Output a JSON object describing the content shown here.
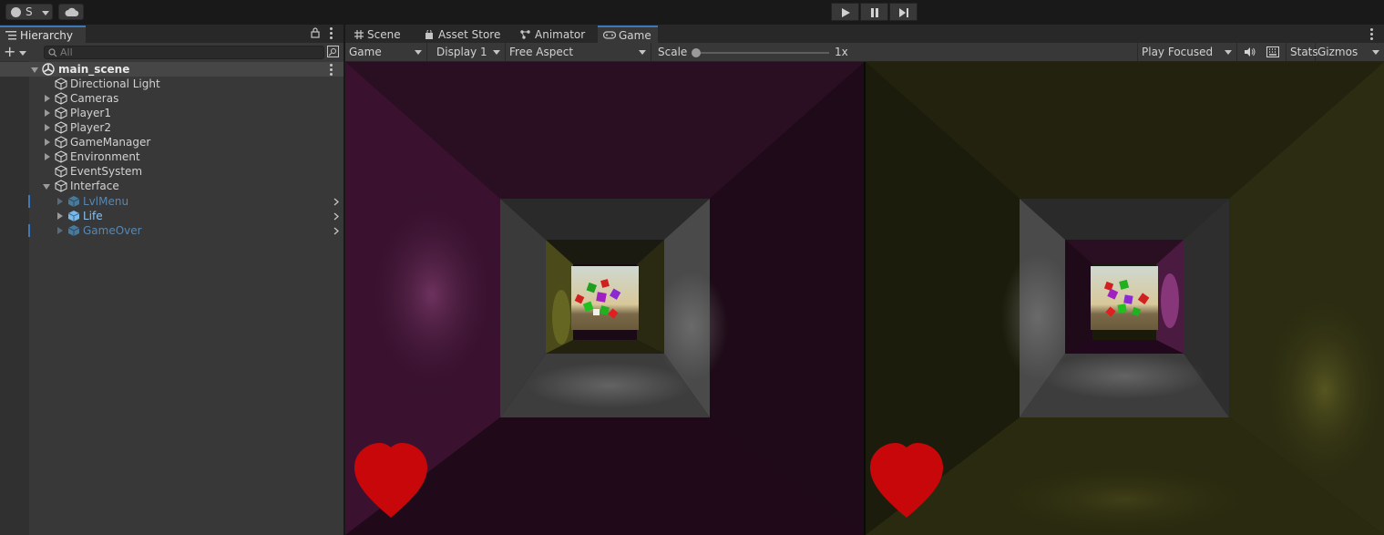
{
  "toolbar": {
    "account_label": "S",
    "play_icon": "play-icon",
    "pause_icon": "pause-icon",
    "step_icon": "step-icon"
  },
  "hierarchy": {
    "tab_label": "Hierarchy",
    "search_placeholder": "All",
    "items": [
      {
        "label": "main_scene",
        "type": "scene",
        "expanded": true
      },
      {
        "label": "Directional Light",
        "type": "object"
      },
      {
        "label": "Cameras",
        "type": "object",
        "has_children": true
      },
      {
        "label": "Player1",
        "type": "object",
        "has_children": true
      },
      {
        "label": "Player2",
        "type": "object",
        "has_children": true
      },
      {
        "label": "GameManager",
        "type": "object",
        "has_children": true
      },
      {
        "label": "Environment",
        "type": "object",
        "has_children": true
      },
      {
        "label": "EventSystem",
        "type": "object"
      },
      {
        "label": "Interface",
        "type": "object",
        "expanded": true
      },
      {
        "label": "LvlMenu",
        "type": "prefab-inactive",
        "has_children": true
      },
      {
        "label": "Life",
        "type": "prefab",
        "has_children": true
      },
      {
        "label": "GameOver",
        "type": "prefab-inactive",
        "has_children": true
      }
    ]
  },
  "tabs": [
    {
      "label": "Scene",
      "icon": "grid-icon"
    },
    {
      "label": "Asset Store",
      "icon": "bag-icon"
    },
    {
      "label": "Animator",
      "icon": "animator-icon"
    },
    {
      "label": "Game",
      "icon": "gamepad-icon",
      "active": true
    }
  ],
  "game_controls": {
    "view_mode": "Game",
    "display": "Display 1",
    "aspect": "Free Aspect",
    "scale_label": "Scale",
    "scale_value": "1x",
    "play_mode": "Play Focused",
    "stats_label": "Stats",
    "gizmos_label": "Gizmos"
  },
  "viewports": [
    {
      "name": "player1-view",
      "tint": "#4a1a3a",
      "accent": "#6a2a5a"
    },
    {
      "name": "player2-view",
      "tint": "#2a2a10",
      "accent": "#4a4a1a"
    }
  ],
  "colors": {
    "heart": "#c8070a",
    "selection": "#3a79bb",
    "prefab": "#7ab0e0"
  }
}
